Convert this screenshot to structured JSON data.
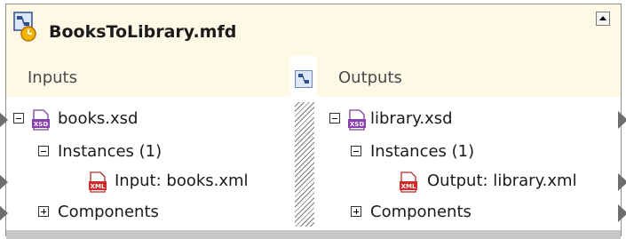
{
  "title": "BooksToLibrary.mfd",
  "icons": {
    "title": "mapping-function-icon",
    "xsd": "xsd-file-icon",
    "xml": "xml-file-icon",
    "collapse": "collapse-arrow-icon",
    "divider_toggle": "panel-toggle-icon"
  },
  "inputs": {
    "header": "Inputs",
    "schema": "books.xsd",
    "instances": "Instances (1)",
    "instance_item": "Input: books.xml",
    "components": "Components"
  },
  "outputs": {
    "header": "Outputs",
    "schema": "library.xsd",
    "instances": "Instances (1)",
    "instance_item": "Output: library.xml",
    "components": "Components"
  }
}
